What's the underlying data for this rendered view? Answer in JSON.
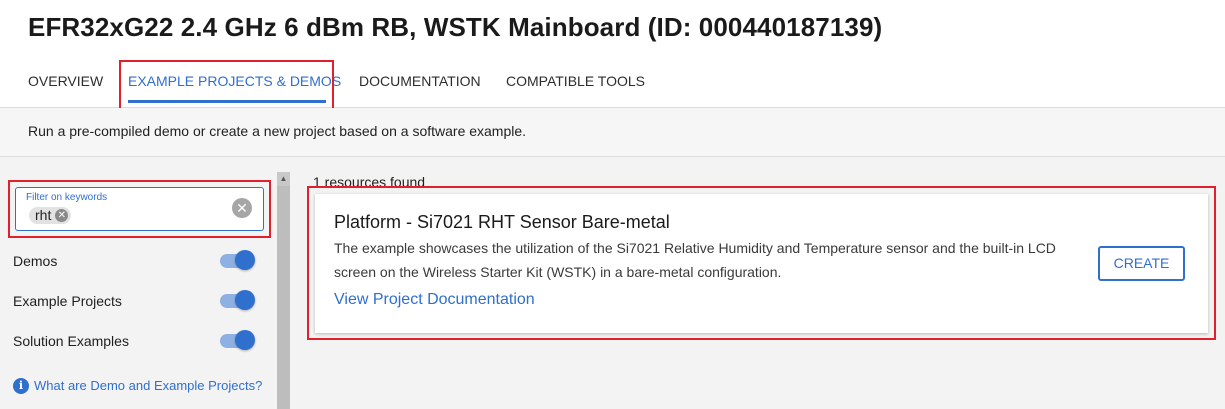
{
  "header": {
    "title": "EFR32xG22 2.4 GHz 6 dBm RB, WSTK Mainboard (ID: 000440187139)",
    "tabs": [
      {
        "label": "OVERVIEW"
      },
      {
        "label": "EXAMPLE PROJECTS & DEMOS",
        "active": true
      },
      {
        "label": "DOCUMENTATION"
      },
      {
        "label": "COMPATIBLE TOOLS"
      }
    ]
  },
  "subbar": {
    "text": "Run a pre-compiled demo or create a new project based on a software example."
  },
  "filters": {
    "keyword_label": "Filter on keywords",
    "keyword_chip": "rht",
    "toggles": [
      {
        "label": "Demos",
        "on": true
      },
      {
        "label": "Example Projects",
        "on": true
      },
      {
        "label": "Solution Examples",
        "on": true
      }
    ],
    "help_link": "What are Demo and Example Projects?"
  },
  "results": {
    "count_text": "1 resources found",
    "items": [
      {
        "title": "Platform - Si7021 RHT Sensor Bare-metal",
        "description": "The example showcases the utilization of the Si7021 Relative Humidity and Temperature sensor and the built-in LCD screen on the Wireless Starter Kit (WSTK) in a bare-metal configuration.",
        "link": "View Project Documentation",
        "button": "CREATE"
      }
    ]
  },
  "colors": {
    "accent": "#2f6fce",
    "annotation": "#e0202a"
  },
  "icons": {
    "clear": "close-circle-icon",
    "chip_remove": "close-icon",
    "help": "info-icon"
  }
}
